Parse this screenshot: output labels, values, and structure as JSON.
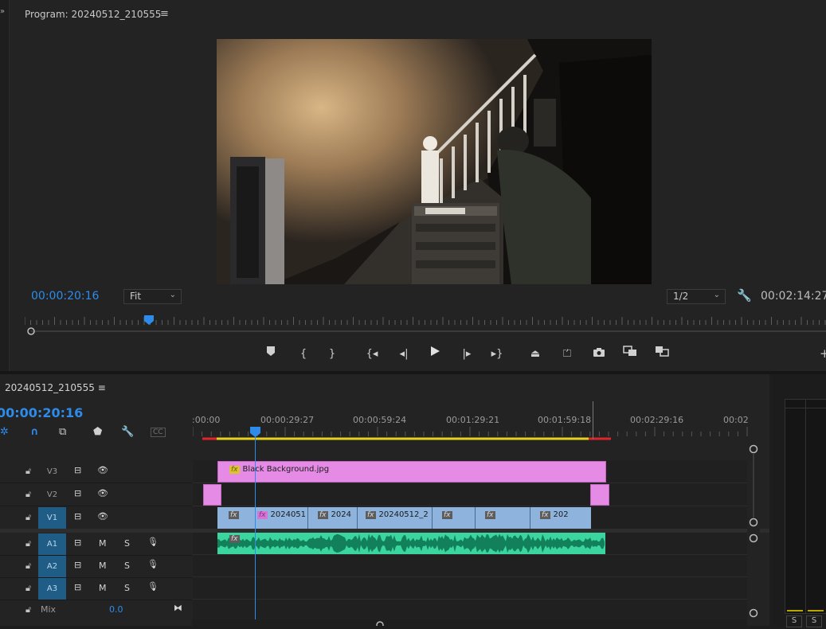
{
  "program": {
    "title": "Program: 20240512_210555",
    "menu_icon": "≡",
    "timecode": "00:00:20:16",
    "fit": "Fit",
    "resolution": "1/2",
    "duration": "00:02:14:27"
  },
  "transport_icons": [
    "add-marker",
    "mark-in",
    "mark-out",
    "go-to-in",
    "step-back",
    "play",
    "step-forward",
    "go-to-out",
    "lift",
    "extract",
    "export-frame",
    "comparison-view",
    "multi-camera"
  ],
  "timeline": {
    "sequence_title": "20240512_210555 ≡",
    "timecode": "00:00:20:16",
    "ruler_labels": [
      ":00:00",
      "00:00:29:27",
      "00:00:59:24",
      "00:01:29:21",
      "00:01:59:18",
      "00:02:29:16",
      "00:02"
    ],
    "tracks": [
      {
        "name": "V3",
        "active": false,
        "type": "video"
      },
      {
        "name": "V2",
        "active": false,
        "type": "video"
      },
      {
        "name": "V1",
        "active": true,
        "type": "video"
      },
      {
        "name": "A1",
        "active": true,
        "type": "audio"
      },
      {
        "name": "A2",
        "active": true,
        "type": "audio"
      },
      {
        "name": "A3",
        "active": true,
        "type": "audio"
      }
    ],
    "mute_label": "M",
    "solo_label": "S",
    "mix_label": "Mix",
    "mix_value": "0.0",
    "clips": {
      "v3_label": "Black Background.jpg",
      "v1_labels": [
        "2024051",
        "2024",
        "20240512_2",
        "",
        "",
        "202"
      ]
    }
  },
  "meter": {
    "solo_labels": [
      "S",
      "S"
    ]
  },
  "colors": {
    "accent": "#2d8ceb",
    "graphic_clip": "#e58be5",
    "video_clip": "#8eb4de",
    "audio_clip": "#3bd6a0",
    "active_track": "#1f5c86"
  }
}
